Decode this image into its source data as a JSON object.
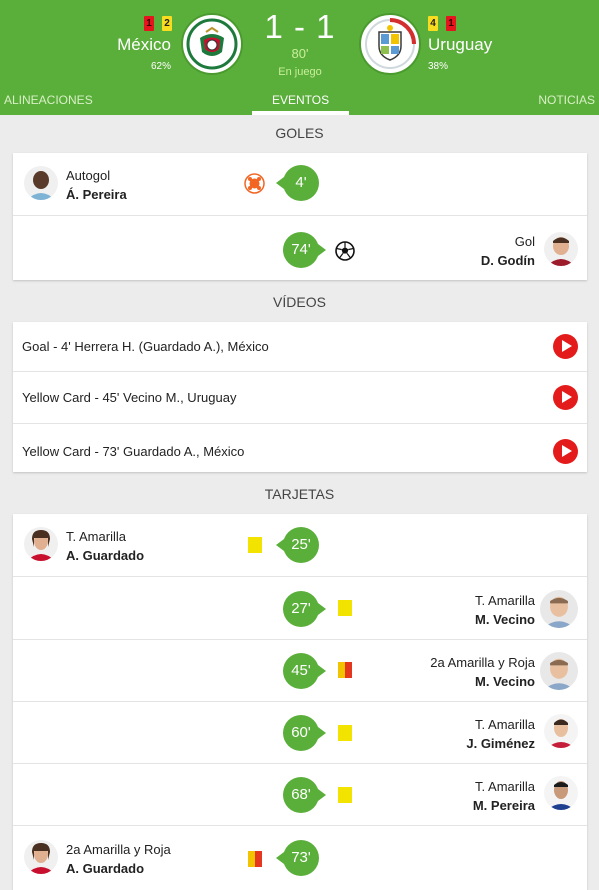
{
  "match": {
    "home": {
      "name": "México",
      "pct": "62%",
      "red_cards": "1",
      "yellow_cards": "2"
    },
    "away": {
      "name": "Uruguay",
      "pct": "38%",
      "yellow_cards": "4",
      "red_cards": "1"
    },
    "score": "1 - 1",
    "minute": "80'",
    "status": "En juego"
  },
  "tabs": [
    {
      "label": "ALINEACIONES",
      "active": false
    },
    {
      "label": "EVENTOS",
      "active": true
    },
    {
      "label": "NOTICIAS",
      "active": false
    }
  ],
  "sections": {
    "goals": "GOLES",
    "videos": "VÍDEOS",
    "cards": "TARJETAS"
  },
  "goals": [
    {
      "side": "home",
      "type": "Autogol",
      "player": "Á. Pereira",
      "minute": "4'",
      "icon": "own-goal-icon"
    },
    {
      "side": "away",
      "type": "Gol",
      "player": "D. Godín",
      "minute": "74'",
      "icon": "soccer-ball-icon"
    }
  ],
  "videos": [
    {
      "label": "Goal - 4' Herrera H. (Guardado A.), México"
    },
    {
      "label": "Yellow Card - 45' Vecino M., Uruguay"
    },
    {
      "label": "Yellow Card - 73' Guardado A., México"
    }
  ],
  "cards": [
    {
      "side": "home",
      "type": "T. Amarilla",
      "player": "A. Guardado",
      "minute": "25'",
      "card": "yellow"
    },
    {
      "side": "away",
      "type": "T. Amarilla",
      "player": "M. Vecino",
      "minute": "27'",
      "card": "yellow"
    },
    {
      "side": "away",
      "type": "2a Amarilla y Roja",
      "player": "M. Vecino",
      "minute": "45'",
      "card": "second-yellow-red"
    },
    {
      "side": "away",
      "type": "T. Amarilla",
      "player": "J. Giménez",
      "minute": "60'",
      "card": "yellow"
    },
    {
      "side": "away",
      "type": "T. Amarilla",
      "player": "M. Pereira",
      "minute": "68'",
      "card": "yellow"
    },
    {
      "side": "home",
      "type": "2a Amarilla y Roja",
      "player": "A. Guardado",
      "minute": "73'",
      "card": "second-yellow-red"
    }
  ],
  "colors": {
    "brand_green": "#5aae3a",
    "yellow_card": "#f2e300",
    "red_card": "#e5141d",
    "play_button": "#e41b1b"
  }
}
